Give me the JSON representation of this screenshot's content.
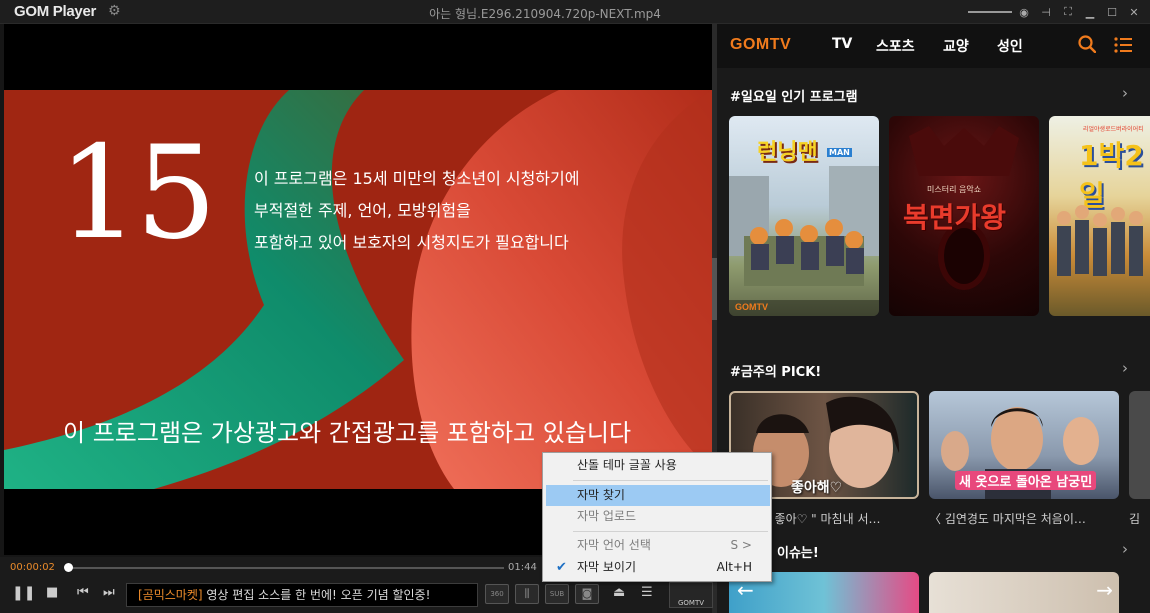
{
  "titlebar": {
    "app_name": "GOM Player",
    "file_title": "아는 형님.E296.210904.720p-NEXT.mp4"
  },
  "video": {
    "rating_number": "15",
    "notice_lines": [
      "이 프로그램은 15세 미만의 청소년이 시청하기에",
      "부적절한 주제, 언어, 모방위험을",
      "포함하고 있어 보호자의 시청지도가 필요합니다"
    ],
    "ad_notice": "이 프로그램은 가상광고와 간접광고를 포함하고 있습니다"
  },
  "player": {
    "time_current": "00:00:02",
    "time_total": "01:44",
    "progress_fraction": 0.002,
    "ticker_tag": "[곰믹스마켓]",
    "ticker_text": " 영상 편집 소스를 한 번에! 오픈 기념 할인중!",
    "btn_360": "360",
    "btn_sub": "SUB",
    "btn_gomtv": "GOMTV"
  },
  "context_menu": {
    "items": [
      {
        "label": "산돌 테마 글꼴 사용",
        "state": "normal"
      },
      {
        "label": "자막 찾기",
        "state": "highlighted"
      },
      {
        "label": "자막 업로드",
        "state": "disabled"
      },
      {
        "label": "자막 언어 선택",
        "shortcut": "S >",
        "state": "disabled"
      },
      {
        "label": "자막 보이기",
        "shortcut": "Alt+H",
        "state": "checked"
      }
    ]
  },
  "panel": {
    "logo": "GOMTV",
    "nav": [
      "TV",
      "스포츠",
      "교양",
      "성인"
    ],
    "section1_title": "#일요일 인기 프로그램",
    "section2_title": "#금주의 PICK!",
    "section3_title": "이슈는!",
    "posters": [
      {
        "title_text": "런닝맨",
        "sub_text": "MAN"
      },
      {
        "title_text": "복면가왕",
        "sub_text": "미스터리 음악쇼"
      },
      {
        "title_text": "1박2일",
        "sub_text": "리얼야생로드버라이어티"
      }
    ],
    "picks": [
      {
        "overlay": "좋아해♡",
        "caption": "〈 그 다 좋아♡ \" 마침내 서…"
      },
      {
        "overlay": "새 옷으로 돌아온 남궁민",
        "caption": "〈 김연경도 마지막은 처음이…"
      },
      {
        "overlay": "",
        "caption": "김"
      }
    ]
  }
}
